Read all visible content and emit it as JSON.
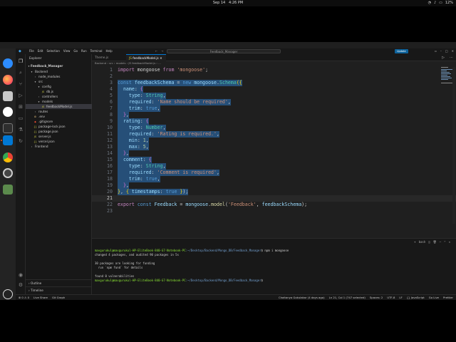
{
  "topbar": {
    "date": "Sep 14",
    "time": "4:26 PM",
    "battery": "12%"
  },
  "titlebar": {
    "menu": [
      "File",
      "Edit",
      "Selection",
      "View",
      "Go",
      "Run",
      "Terminal",
      "Help"
    ],
    "search": "Feedback_Manager",
    "update_label": "Update"
  },
  "sidebar": {
    "title": "Explorer",
    "project": "Feedback_Manager",
    "tree": [
      {
        "label": "Backend",
        "icon": "chevron-down-icon"
      },
      {
        "label": "node_modules",
        "icon": "chevron-right-icon"
      },
      {
        "label": "src",
        "icon": "chevron-down-icon"
      },
      {
        "label": "config",
        "icon": "chevron-down-icon"
      },
      {
        "label": "db.js",
        "icon": "js-file-icon"
      },
      {
        "label": "controllers",
        "icon": "chevron-right-icon"
      },
      {
        "label": "models",
        "icon": "chevron-down-icon"
      },
      {
        "label": "feedbackModel.js",
        "icon": "js-file-icon"
      },
      {
        "label": "routes",
        "icon": "chevron-right-icon"
      },
      {
        "label": ".env",
        "icon": "env-file-icon"
      },
      {
        "label": ".gitignore",
        "icon": "git-file-icon"
      },
      {
        "label": "package-lock.json",
        "icon": "json-file-icon"
      },
      {
        "label": "package.json",
        "icon": "json-file-icon"
      },
      {
        "label": "server.js",
        "icon": "js-file-icon"
      },
      {
        "label": "vercel.json",
        "icon": "json-file-icon"
      },
      {
        "label": "Frontend",
        "icon": "chevron-right-icon"
      }
    ],
    "outline": "Outline",
    "timeline": "Timeline"
  },
  "tabs": [
    {
      "label": "Theme.js"
    },
    {
      "label": "feedbackModel.js"
    }
  ],
  "breadcrumb": "Backend › src › models › JS feedbackModel.js › ...",
  "code_lines": [
    {
      "n": "1",
      "t": [
        [
          "kw",
          "import"
        ],
        [
          "pl",
          " mongoose "
        ],
        [
          "kw",
          "from"
        ],
        [
          "pl",
          " "
        ],
        [
          "str",
          "'mongoose'"
        ],
        [
          "pl",
          ";"
        ]
      ]
    },
    {
      "n": "2",
      "t": []
    },
    {
      "n": "3",
      "t": [
        [
          "kw2",
          "const"
        ],
        [
          "pl",
          " "
        ],
        [
          "var",
          "feedbackSchema"
        ],
        [
          "pl",
          " = "
        ],
        [
          "kw2",
          "new"
        ],
        [
          "pl",
          " "
        ],
        [
          "var",
          "mongoose"
        ],
        [
          "pl",
          "."
        ],
        [
          "cls",
          "Schema"
        ],
        [
          "br",
          "({"
        ]
      ]
    },
    {
      "n": "4",
      "t": [
        [
          "pl",
          "  "
        ],
        [
          "var",
          "name"
        ],
        [
          "pl",
          ": "
        ],
        [
          "br2",
          "{"
        ]
      ]
    },
    {
      "n": "5",
      "t": [
        [
          "pl",
          "    "
        ],
        [
          "var",
          "type"
        ],
        [
          "pl",
          ": "
        ],
        [
          "cls",
          "String"
        ],
        [
          "pl",
          ","
        ]
      ]
    },
    {
      "n": "6",
      "t": [
        [
          "pl",
          "    "
        ],
        [
          "var",
          "required"
        ],
        [
          "pl",
          ": "
        ],
        [
          "str",
          "'Name should be required'"
        ],
        [
          "pl",
          ","
        ]
      ]
    },
    {
      "n": "7",
      "t": [
        [
          "pl",
          "    "
        ],
        [
          "var",
          "trim"
        ],
        [
          "pl",
          ": "
        ],
        [
          "kw2",
          "true"
        ],
        [
          "pl",
          ","
        ]
      ]
    },
    {
      "n": "8",
      "t": [
        [
          "pl",
          "  "
        ],
        [
          "br2",
          "}"
        ],
        [
          "pl",
          ","
        ]
      ]
    },
    {
      "n": "9",
      "t": [
        [
          "pl",
          "  "
        ],
        [
          "var",
          "rating"
        ],
        [
          "pl",
          ": "
        ],
        [
          "br2",
          "{"
        ]
      ]
    },
    {
      "n": "10",
      "t": [
        [
          "pl",
          "    "
        ],
        [
          "var",
          "type"
        ],
        [
          "pl",
          ": "
        ],
        [
          "cls",
          "Number"
        ],
        [
          "pl",
          ","
        ]
      ]
    },
    {
      "n": "11",
      "t": [
        [
          "pl",
          "    "
        ],
        [
          "var",
          "required"
        ],
        [
          "pl",
          ": "
        ],
        [
          "str",
          "'Rating is required.'"
        ],
        [
          "pl",
          ","
        ]
      ]
    },
    {
      "n": "12",
      "t": [
        [
          "pl",
          "    "
        ],
        [
          "var",
          "min"
        ],
        [
          "pl",
          ": "
        ],
        [
          "num",
          "1"
        ],
        [
          "pl",
          ","
        ]
      ]
    },
    {
      "n": "13",
      "t": [
        [
          "pl",
          "    "
        ],
        [
          "var",
          "max"
        ],
        [
          "pl",
          ": "
        ],
        [
          "num",
          "5"
        ],
        [
          "pl",
          ","
        ]
      ]
    },
    {
      "n": "14",
      "t": [
        [
          "pl",
          "  "
        ],
        [
          "br2",
          "}"
        ],
        [
          "pl",
          ","
        ]
      ]
    },
    {
      "n": "15",
      "t": [
        [
          "pl",
          "  "
        ],
        [
          "var",
          "comment"
        ],
        [
          "pl",
          ": "
        ],
        [
          "br2",
          "{"
        ]
      ]
    },
    {
      "n": "16",
      "t": [
        [
          "pl",
          "    "
        ],
        [
          "var",
          "type"
        ],
        [
          "pl",
          ": "
        ],
        [
          "cls",
          "String"
        ],
        [
          "pl",
          ","
        ]
      ]
    },
    {
      "n": "17",
      "t": [
        [
          "pl",
          "    "
        ],
        [
          "var",
          "required"
        ],
        [
          "pl",
          ": "
        ],
        [
          "str",
          "'Comment is required'"
        ],
        [
          "pl",
          ","
        ]
      ]
    },
    {
      "n": "18",
      "t": [
        [
          "pl",
          "    "
        ],
        [
          "var",
          "trim"
        ],
        [
          "pl",
          ": "
        ],
        [
          "kw2",
          "true"
        ],
        [
          "pl",
          ","
        ]
      ]
    },
    {
      "n": "19",
      "t": [
        [
          "pl",
          "  "
        ],
        [
          "br2",
          "}"
        ],
        [
          "pl",
          ","
        ]
      ]
    },
    {
      "n": "20",
      "t": [
        [
          "br",
          "}"
        ],
        [
          "pl",
          ", "
        ],
        [
          "br",
          "{"
        ],
        [
          "pl",
          " "
        ],
        [
          "var",
          "timestamps"
        ],
        [
          "pl",
          ": "
        ],
        [
          "kw2",
          "true"
        ],
        [
          "pl",
          " "
        ],
        [
          "br",
          "}"
        ],
        [
          "pl",
          ");"
        ]
      ]
    },
    {
      "n": "21",
      "t": []
    },
    {
      "n": "22",
      "t": [
        [
          "kw",
          "export"
        ],
        [
          "pl",
          " "
        ],
        [
          "kw2",
          "const"
        ],
        [
          "pl",
          " "
        ],
        [
          "var",
          "Feedback"
        ],
        [
          "pl",
          " = "
        ],
        [
          "var",
          "mongoose"
        ],
        [
          "pl",
          "."
        ],
        [
          "fn",
          "model"
        ],
        [
          "pl",
          "("
        ],
        [
          "str",
          "'Feedback'"
        ],
        [
          "pl",
          ", "
        ],
        [
          "var",
          "feedbackSchema"
        ],
        [
          "pl",
          ");"
        ]
      ]
    },
    {
      "n": "23",
      "t": []
    }
  ],
  "terminal": {
    "shell_label": "bash",
    "lines": [
      {
        "prompt": "mavgurukul@mavgurukul-HP-EliteBook-840-G7-Notebook-PC",
        "path": ":~/Desktop/Backend/Mongo_DB/Feedback_Manager",
        "cmd": "$ npm i mongoose"
      },
      {
        "text": "changed 4 packages, and audited 90 packages in 5s"
      },
      {
        "text": ""
      },
      {
        "text": "30 packages are looking for funding"
      },
      {
        "text": "  run `npm fund` for details"
      },
      {
        "text": ""
      },
      {
        "text": "found 0 vulnerabilities"
      },
      {
        "prompt": "mavgurukul@mavgurukul-HP-EliteBook-840-G7-Notebook-PC",
        "path": ":~/Desktop/Backend/Mongo_DB/Feedback_Manager",
        "cmd": "$ "
      }
    ]
  },
  "statusbar": {
    "left": [
      "⊗ 0 ⚠ 0",
      "Live Share",
      "Git Graph"
    ],
    "right": [
      "Chaitanya Gokulakar (4 days ago)",
      "Ln 21, Col 1 (747 selected)",
      "Spaces: 2",
      "UTF-8",
      "LF",
      "{} JavaScript",
      "Go Live",
      "Prettier"
    ]
  }
}
